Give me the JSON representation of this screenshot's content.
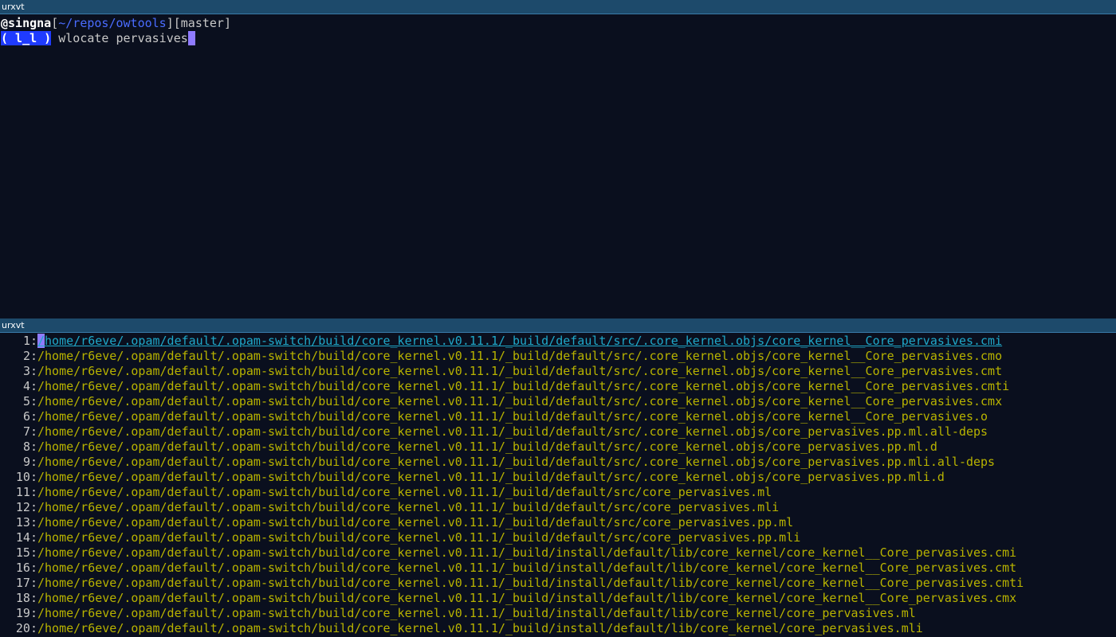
{
  "top_pane": {
    "title": "urxvt",
    "prompt": {
      "user": "@singna",
      "open_bracket": "[",
      "cwd": "~/repos/owtools",
      "close_bracket": "]",
      "branch": "[master]",
      "face": "( l_l )",
      "command": " wlocate pervasives"
    }
  },
  "bottom_pane": {
    "title": "urxvt",
    "results": [
      {
        "num": "1:",
        "first": "/",
        "rest": "home/r6eve/.opam/default/.opam-switch/build/core_kernel.v0.11.1/_build/default/src/.core_kernel.objs/core_kernel__Core_pervasives.cmi"
      },
      {
        "num": "2:",
        "path": "/home/r6eve/.opam/default/.opam-switch/build/core_kernel.v0.11.1/_build/default/src/.core_kernel.objs/core_kernel__Core_pervasives.cmo"
      },
      {
        "num": "3:",
        "path": "/home/r6eve/.opam/default/.opam-switch/build/core_kernel.v0.11.1/_build/default/src/.core_kernel.objs/core_kernel__Core_pervasives.cmt"
      },
      {
        "num": "4:",
        "path": "/home/r6eve/.opam/default/.opam-switch/build/core_kernel.v0.11.1/_build/default/src/.core_kernel.objs/core_kernel__Core_pervasives.cmti"
      },
      {
        "num": "5:",
        "path": "/home/r6eve/.opam/default/.opam-switch/build/core_kernel.v0.11.1/_build/default/src/.core_kernel.objs/core_kernel__Core_pervasives.cmx"
      },
      {
        "num": "6:",
        "path": "/home/r6eve/.opam/default/.opam-switch/build/core_kernel.v0.11.1/_build/default/src/.core_kernel.objs/core_kernel__Core_pervasives.o"
      },
      {
        "num": "7:",
        "path": "/home/r6eve/.opam/default/.opam-switch/build/core_kernel.v0.11.1/_build/default/src/.core_kernel.objs/core_pervasives.pp.ml.all-deps"
      },
      {
        "num": "8:",
        "path": "/home/r6eve/.opam/default/.opam-switch/build/core_kernel.v0.11.1/_build/default/src/.core_kernel.objs/core_pervasives.pp.ml.d"
      },
      {
        "num": "9:",
        "path": "/home/r6eve/.opam/default/.opam-switch/build/core_kernel.v0.11.1/_build/default/src/.core_kernel.objs/core_pervasives.pp.mli.all-deps"
      },
      {
        "num": "10:",
        "path": "/home/r6eve/.opam/default/.opam-switch/build/core_kernel.v0.11.1/_build/default/src/.core_kernel.objs/core_pervasives.pp.mli.d"
      },
      {
        "num": "11:",
        "path": "/home/r6eve/.opam/default/.opam-switch/build/core_kernel.v0.11.1/_build/default/src/core_pervasives.ml"
      },
      {
        "num": "12:",
        "path": "/home/r6eve/.opam/default/.opam-switch/build/core_kernel.v0.11.1/_build/default/src/core_pervasives.mli"
      },
      {
        "num": "13:",
        "path": "/home/r6eve/.opam/default/.opam-switch/build/core_kernel.v0.11.1/_build/default/src/core_pervasives.pp.ml"
      },
      {
        "num": "14:",
        "path": "/home/r6eve/.opam/default/.opam-switch/build/core_kernel.v0.11.1/_build/default/src/core_pervasives.pp.mli"
      },
      {
        "num": "15:",
        "path": "/home/r6eve/.opam/default/.opam-switch/build/core_kernel.v0.11.1/_build/install/default/lib/core_kernel/core_kernel__Core_pervasives.cmi"
      },
      {
        "num": "16:",
        "path": "/home/r6eve/.opam/default/.opam-switch/build/core_kernel.v0.11.1/_build/install/default/lib/core_kernel/core_kernel__Core_pervasives.cmt"
      },
      {
        "num": "17:",
        "path": "/home/r6eve/.opam/default/.opam-switch/build/core_kernel.v0.11.1/_build/install/default/lib/core_kernel/core_kernel__Core_pervasives.cmti"
      },
      {
        "num": "18:",
        "path": "/home/r6eve/.opam/default/.opam-switch/build/core_kernel.v0.11.1/_build/install/default/lib/core_kernel/core_kernel__Core_pervasives.cmx"
      },
      {
        "num": "19:",
        "path": "/home/r6eve/.opam/default/.opam-switch/build/core_kernel.v0.11.1/_build/install/default/lib/core_kernel/core_pervasives.ml"
      },
      {
        "num": "20:",
        "path": "/home/r6eve/.opam/default/.opam-switch/build/core_kernel.v0.11.1/_build/install/default/lib/core_kernel/core_pervasives.mli"
      }
    ]
  },
  "colors": {
    "background": "#0a0f1e",
    "titlebar": "#1d4a6b",
    "path_accent": "#4a6cff",
    "face_bg": "#1f3bff",
    "result_text": "#b8b300",
    "selected_text": "#1fa8c9",
    "cursor": "#8f7bff"
  }
}
